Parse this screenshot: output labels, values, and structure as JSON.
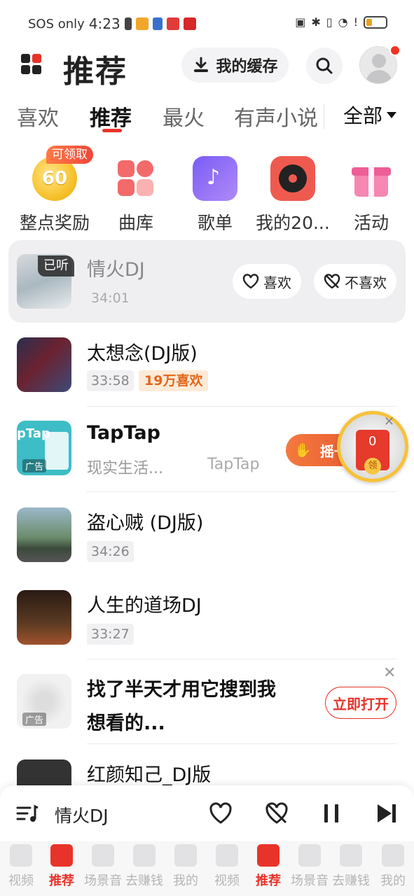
{
  "status_bar": {
    "network": "SOS only",
    "time": "4:23"
  },
  "header": {
    "title": "推荐",
    "cache_label": "我的缓存"
  },
  "tabs": [
    {
      "label": "喜欢"
    },
    {
      "label": "推荐"
    },
    {
      "label": "最火"
    },
    {
      "label": "有声小说"
    }
  ],
  "tab_all": "全部",
  "quick": {
    "claim_badge": "可领取",
    "items": [
      {
        "label": "整点奖励",
        "icon_text": "60",
        "icon": "coin-icon"
      },
      {
        "label": "曲库",
        "icon": "library-icon"
      },
      {
        "label": "歌单",
        "icon": "playlist-icon"
      },
      {
        "label": "我的20...",
        "icon": "record-icon"
      },
      {
        "label": "活动",
        "icon": "gift-icon"
      }
    ]
  },
  "songs": [
    {
      "title": "情火DJ",
      "duration": "34:01",
      "badge": "已听",
      "like": "喜欢",
      "dislike": "不喜欢"
    },
    {
      "title": "太想念(DJ版)",
      "duration": "33:58",
      "likes": "19万喜欢"
    },
    {
      "title": "TapTap",
      "subtitle": "现实生活...",
      "brand": "TapTap",
      "ad": "广告",
      "shake": "摇一",
      "thumb_text": "pTap"
    },
    {
      "title": "盗心贼 (DJ版)",
      "duration": "34:26"
    },
    {
      "title": "人生的道场DJ",
      "duration": "33:27"
    },
    {
      "title": "找了半天才用它搜到我",
      "title2": "想看的...",
      "ad": "广告",
      "open": "立即打开"
    },
    {
      "title": "红颜知己_DJ版"
    }
  ],
  "red_packet": {
    "amount": "0",
    "claim": "领"
  },
  "player": {
    "name": "情火DJ"
  },
  "bottom_nav": [
    {
      "label": "视频"
    },
    {
      "label": "推荐"
    },
    {
      "label": "场景音"
    },
    {
      "label": "去赚钱"
    },
    {
      "label": "我的"
    },
    {
      "label": "视频"
    },
    {
      "label": "推荐"
    },
    {
      "label": "场景音"
    },
    {
      "label": "去赚钱"
    },
    {
      "label": "我的"
    }
  ],
  "colors": {
    "accent": "#e8332a",
    "brand_orange": "#f37a3e"
  }
}
